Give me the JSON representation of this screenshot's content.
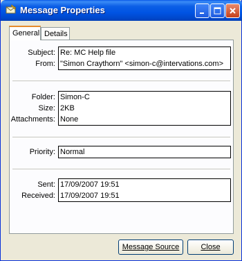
{
  "window": {
    "title": "Message Properties"
  },
  "tabs": [
    {
      "label": "General",
      "active": true
    },
    {
      "label": "Details",
      "active": false
    }
  ],
  "general": {
    "subject": {
      "label": "Subject:",
      "value": "Re: MC Help file"
    },
    "from": {
      "label": "From:",
      "value": "\"Simon Craythorn\" <simon-c@intervations.com>"
    },
    "folder": {
      "label": "Folder:",
      "value": "Simon-C"
    },
    "size": {
      "label": "Size:",
      "value": "2KB"
    },
    "attachments": {
      "label": "Attachments:",
      "value": "None"
    },
    "priority": {
      "label": "Priority:",
      "value": "Normal"
    },
    "sent": {
      "label": "Sent:",
      "value": "17/09/2007 19:51"
    },
    "received": {
      "label": "Received:",
      "value": "17/09/2007 19:51"
    }
  },
  "buttons": {
    "message_source": "Message Source",
    "close": "Close"
  },
  "icons": {
    "window": "envelope-icon",
    "minimize": "minimize-icon",
    "maximize": "maximize-icon",
    "close": "close-icon"
  },
  "colors": {
    "titlebar": "#0054e3",
    "close_button": "#c6401b",
    "active_tab_accent": "#e68b2c"
  }
}
